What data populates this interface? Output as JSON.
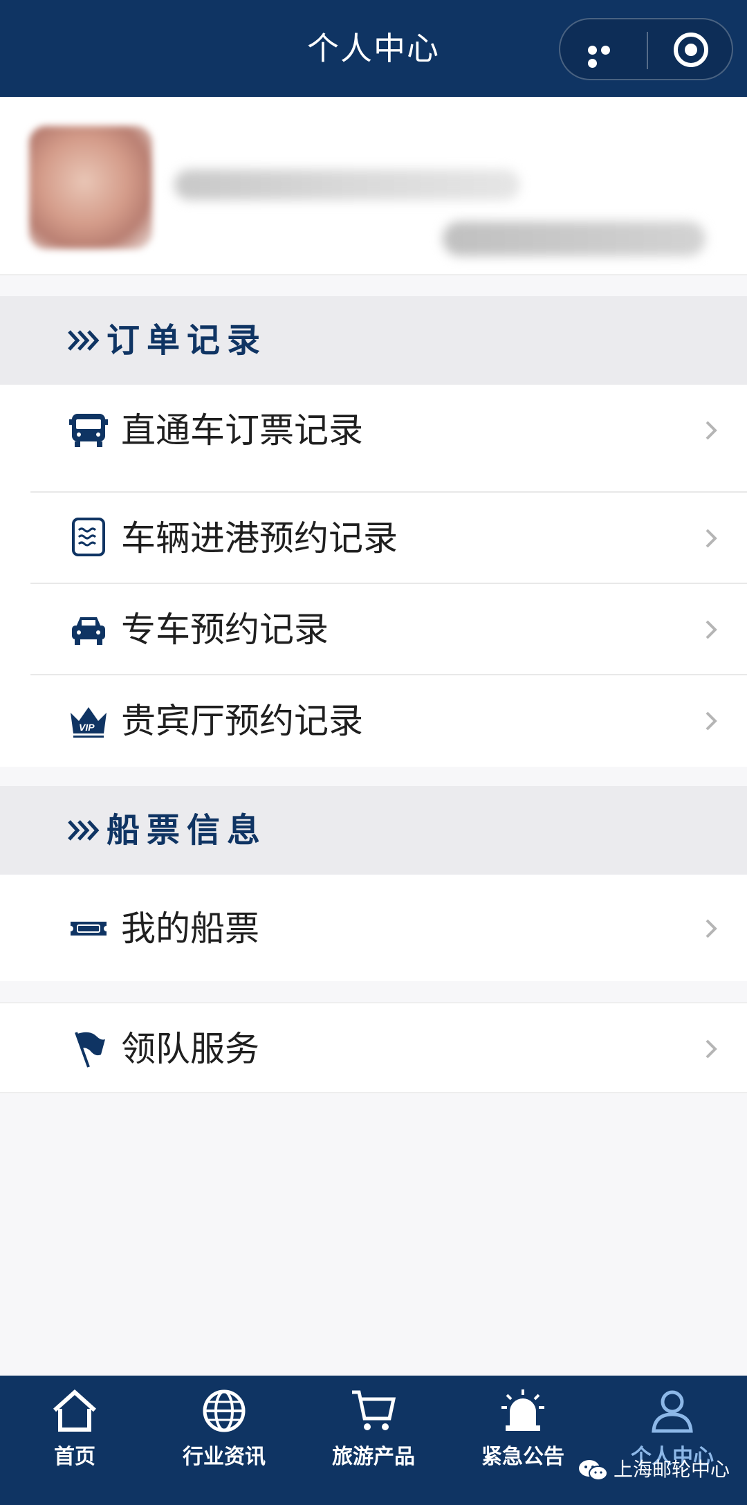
{
  "header": {
    "title": "个人中心",
    "more_icon": "more-dots-icon",
    "close_icon": "target-icon"
  },
  "profile": {
    "avatar_icon": "avatar-blurred",
    "name": "",
    "phone": ""
  },
  "sections": [
    {
      "title": "订单记录",
      "items": [
        {
          "icon": "bus-icon",
          "label": "直通车订票记录"
        },
        {
          "icon": "waves-card-icon",
          "label": "车辆进港预约记录"
        },
        {
          "icon": "car-icon",
          "label": "专车预约记录"
        },
        {
          "icon": "vip-crown-icon",
          "label": "贵宾厅预约记录"
        }
      ]
    },
    {
      "title": "船票信息",
      "items": [
        {
          "icon": "ticket-icon",
          "label": "我的船票"
        }
      ]
    }
  ],
  "extra_item": {
    "icon": "flag-icon",
    "label": "领队服务"
  },
  "tabbar": [
    {
      "icon": "home-icon",
      "label": "首页"
    },
    {
      "icon": "globe-icon",
      "label": "行业资讯"
    },
    {
      "icon": "cart-icon",
      "label": "旅游产品"
    },
    {
      "icon": "alarm-icon",
      "label": "紧急公告"
    },
    {
      "icon": "user-icon",
      "label": "个人中心",
      "active": true
    }
  ],
  "watermark": {
    "icon": "wechat-icon",
    "text": "上海邮轮中心"
  },
  "colors": {
    "brand": "#0f3463",
    "active_tab": "#8db8e8",
    "section_bg": "#ebebee"
  }
}
